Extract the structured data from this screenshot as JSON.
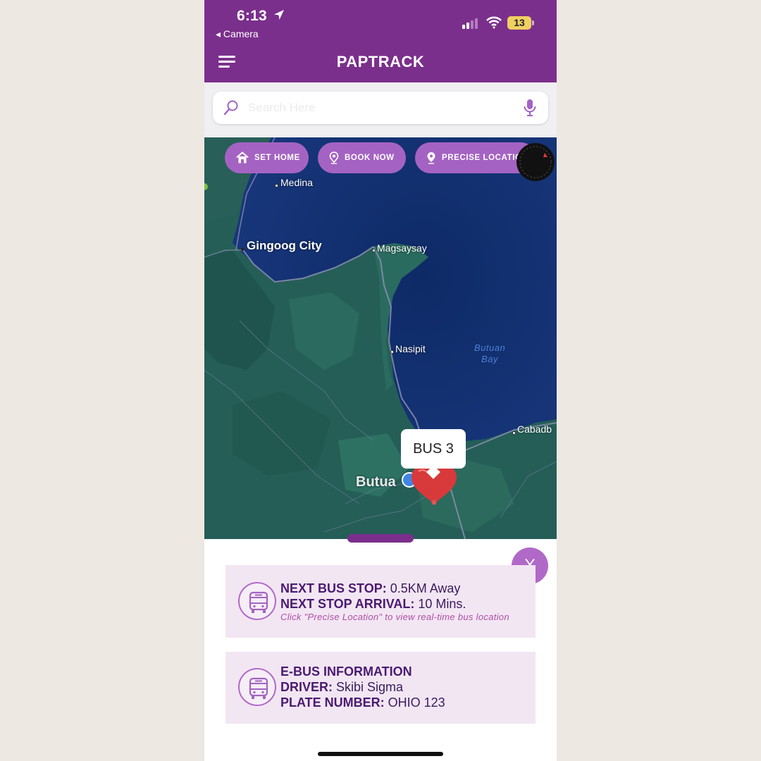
{
  "status_bar": {
    "time": "6:13",
    "back_label": "◂ Camera",
    "battery": "13"
  },
  "header": {
    "title": "PAPTRACK"
  },
  "search": {
    "placeholder": "Search Here"
  },
  "map_actions": {
    "set_home": "SET HOME",
    "book_now": "BOOK NOW",
    "precise_location": "PRECISE LOCATION"
  },
  "map": {
    "places": {
      "medina": "Medina",
      "gingoog": "Gingoog City",
      "magsaysay": "Magsaysay",
      "nasipit": "Nasipit",
      "bay_line1": "Butuan",
      "bay_line2": "Bay",
      "cabadbaran": "Cabadb",
      "butuan": "Butua"
    },
    "bus_marker": "BUS 3"
  },
  "sheet": {
    "close_label": "X",
    "next_stop": {
      "stop_label": "NEXT BUS STOP:",
      "stop_value": " 0.5KM Away",
      "arrival_label": "NEXT STOP ARRIVAL:",
      "arrival_value": " 10 Mins.",
      "hint": "Click \"Precise Location\" to view real-time bus location"
    },
    "bus_info": {
      "title": "E-BUS INFORMATION",
      "driver_label": "DRIVER:",
      "driver_value": " Skibi Sigma",
      "plate_label": "PLATE NUMBER:",
      "plate_value": " OHIO 123"
    }
  },
  "colors": {
    "brand_purple": "#7b2f8c",
    "accent_lilac": "#a463c2",
    "card_bg": "#f2e6f3"
  }
}
